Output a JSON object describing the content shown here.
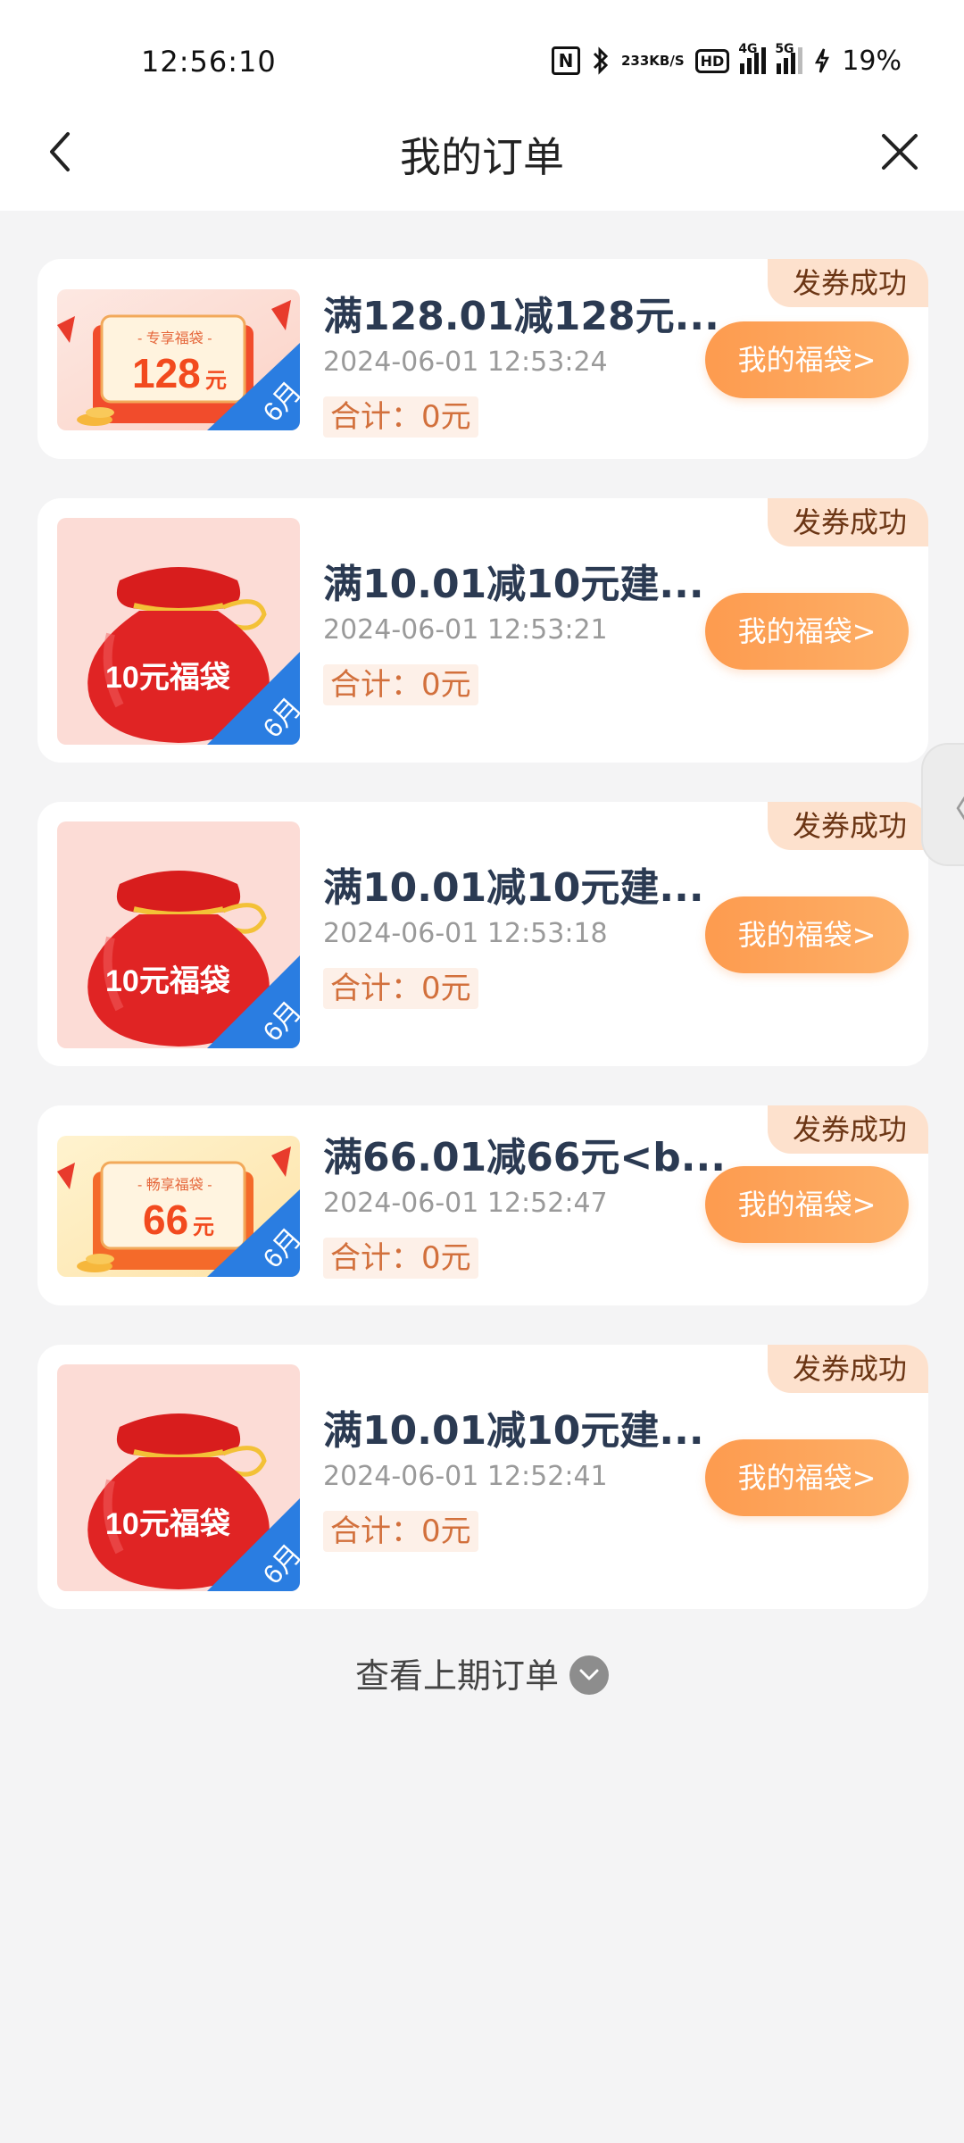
{
  "status": {
    "time": "12:56:10",
    "speed_top": "233",
    "speed_bottom": "KB/S",
    "hd": "HD",
    "net1": "4G",
    "net2": "5G",
    "battery": "19%"
  },
  "nav": {
    "title": "我的订单"
  },
  "orders": [
    {
      "badge": "发券成功",
      "title": "满128.01减128元...",
      "date": "2024-06-01 12:53:24",
      "total": "合计：0元",
      "button": "我的福袋>",
      "thumb": {
        "kind": "coupon",
        "top_label": "- 专享福袋 -",
        "amount": "128",
        "unit": "元",
        "month": "6月"
      }
    },
    {
      "badge": "发券成功",
      "title": "满10.01减10元建...",
      "date": "2024-06-01 12:53:21",
      "total": "合计：0元",
      "button": "我的福袋>",
      "thumb": {
        "kind": "bag",
        "label": "10元福袋",
        "month": "6月"
      }
    },
    {
      "badge": "发券成功",
      "title": "满10.01减10元建...",
      "date": "2024-06-01 12:53:18",
      "total": "合计：0元",
      "button": "我的福袋>",
      "thumb": {
        "kind": "bag",
        "label": "10元福袋",
        "month": "6月"
      }
    },
    {
      "badge": "发券成功",
      "title": "满66.01减66元<b...",
      "date": "2024-06-01 12:52:47",
      "total": "合计：0元",
      "button": "我的福袋>",
      "thumb": {
        "kind": "coupon",
        "top_label": "- 畅享福袋 -",
        "amount": "66",
        "unit": "元",
        "month": "6月"
      }
    },
    {
      "badge": "发券成功",
      "title": "满10.01减10元建...",
      "date": "2024-06-01 12:52:41",
      "total": "合计：0元",
      "button": "我的福袋>",
      "thumb": {
        "kind": "bag",
        "label": "10元福袋",
        "month": "6月"
      }
    }
  ],
  "footer": {
    "more_label": "查看上期订单"
  },
  "side_handle": {
    "glyph": "〈"
  },
  "colors": {
    "accent": "#fd9b4f",
    "badge_bg": "#fde1cd",
    "title": "#2b3a52",
    "total": "#d2703c",
    "ribbon": "#2a7de1"
  }
}
